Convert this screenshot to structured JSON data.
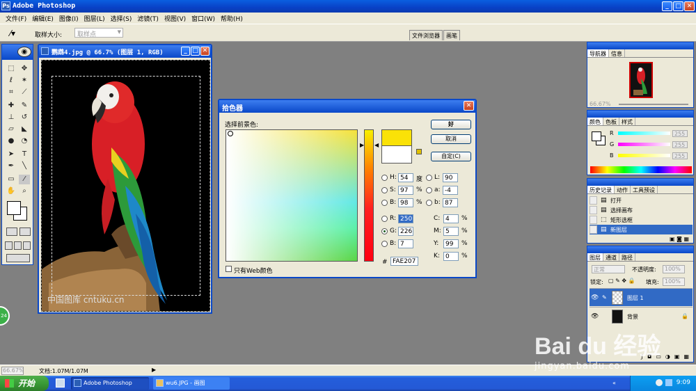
{
  "window": {
    "title": "Adobe Photoshop",
    "logo": "ps-icon"
  },
  "menu": [
    "文件(F)",
    "编辑(E)",
    "图像(I)",
    "图层(L)",
    "选择(S)",
    "滤镜(T)",
    "视图(V)",
    "窗口(W)",
    "帮助(H)"
  ],
  "options": {
    "sample_label": "取样大小:",
    "sample_value": "取样点",
    "well_tabs": [
      "文件浏览器",
      "画笔"
    ]
  },
  "document": {
    "title": "鹦鹉4.jpg @ 66.7% (图层 1, RGB)",
    "watermark": "中国图库 cntuku.cn"
  },
  "picker": {
    "title": "拾色器",
    "fg_label": "选择前景色:",
    "ok": "好",
    "cancel": "取消",
    "custom": "自定(C)",
    "hsb": [
      {
        "k": "H:",
        "v": "54",
        "u": "度"
      },
      {
        "k": "S:",
        "v": "97",
        "u": "%"
      },
      {
        "k": "B:",
        "v": "98",
        "u": "%"
      }
    ],
    "lab": [
      {
        "k": "L:",
        "v": "90"
      },
      {
        "k": "a:",
        "v": "-4"
      },
      {
        "k": "b:",
        "v": "87"
      }
    ],
    "rgb": [
      {
        "k": "R:",
        "v": "250"
      },
      {
        "k": "G:",
        "v": "226"
      },
      {
        "k": "B:",
        "v": "7"
      }
    ],
    "cmyk": [
      {
        "k": "C:",
        "v": "4",
        "u": "%"
      },
      {
        "k": "M:",
        "v": "5",
        "u": "%"
      },
      {
        "k": "Y:",
        "v": "99",
        "u": "%"
      },
      {
        "k": "K:",
        "v": "0",
        "u": "%"
      }
    ],
    "hex_label": "#",
    "hex": "FAE207",
    "web_only": "只有Web颜色",
    "new_color": "#FAE207",
    "old_color": "#FFFFFF"
  },
  "navigator": {
    "tabs": [
      "导航器",
      "信息"
    ],
    "zoom": "66.67%"
  },
  "color_panel": {
    "tabs": [
      "颜色",
      "色板",
      "样式"
    ],
    "rows": [
      {
        "k": "R",
        "v": "255"
      },
      {
        "k": "G",
        "v": "255"
      },
      {
        "k": "B",
        "v": "255"
      }
    ]
  },
  "history": {
    "tabs": [
      "历史记录",
      "动作",
      "工具预设"
    ],
    "items": [
      {
        "icon": "open-icon",
        "label": "打开"
      },
      {
        "icon": "canvas-icon",
        "label": "选择画布"
      },
      {
        "icon": "marquee-icon",
        "label": "矩形选框"
      },
      {
        "icon": "layer-icon",
        "label": "新图层"
      }
    ]
  },
  "layers": {
    "tabs": [
      "图层",
      "通道",
      "路径"
    ],
    "mode": "正常",
    "opacity_label": "不透明度:",
    "opacity": "100%",
    "lock_label": "锁定:",
    "fill_label": "填充:",
    "fill": "100%",
    "items": [
      {
        "name": "图层 1",
        "active": true
      },
      {
        "name": "背景",
        "active": false
      }
    ]
  },
  "status": {
    "zoom": "66.67%",
    "doc": "文档:1.07M/1.07M"
  },
  "taskbar": {
    "start": "开始",
    "tasks": [
      "Adobe Photoshop",
      "wu6.JPG - 画图"
    ],
    "clock": "9:09"
  },
  "overlay": {
    "badge": "24",
    "baidu": "Bai du 经验",
    "baidu_url": "jingyan.baidu.com"
  }
}
